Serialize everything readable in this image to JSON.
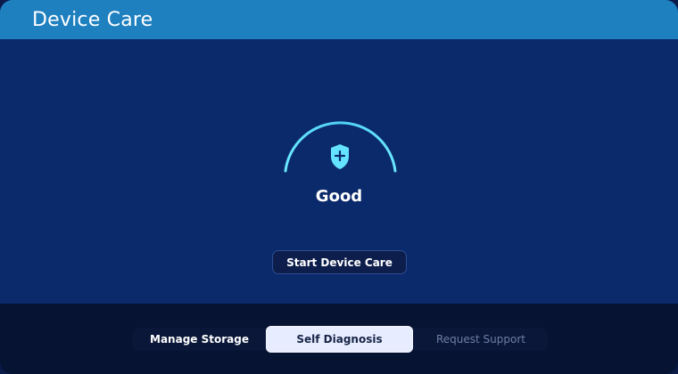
{
  "header": {
    "title": "Device Care"
  },
  "main": {
    "status_text": "Good",
    "start_button_label": "Start Device Care",
    "icon": "shield-plus-icon",
    "colors": {
      "accent": "#63e3ff",
      "accent_soft": "#49bde0"
    }
  },
  "tabs": [
    {
      "label": "Manage Storage",
      "state": "normal"
    },
    {
      "label": "Self Diagnosis",
      "state": "selected"
    },
    {
      "label": "Request Support",
      "state": "disabled"
    }
  ]
}
